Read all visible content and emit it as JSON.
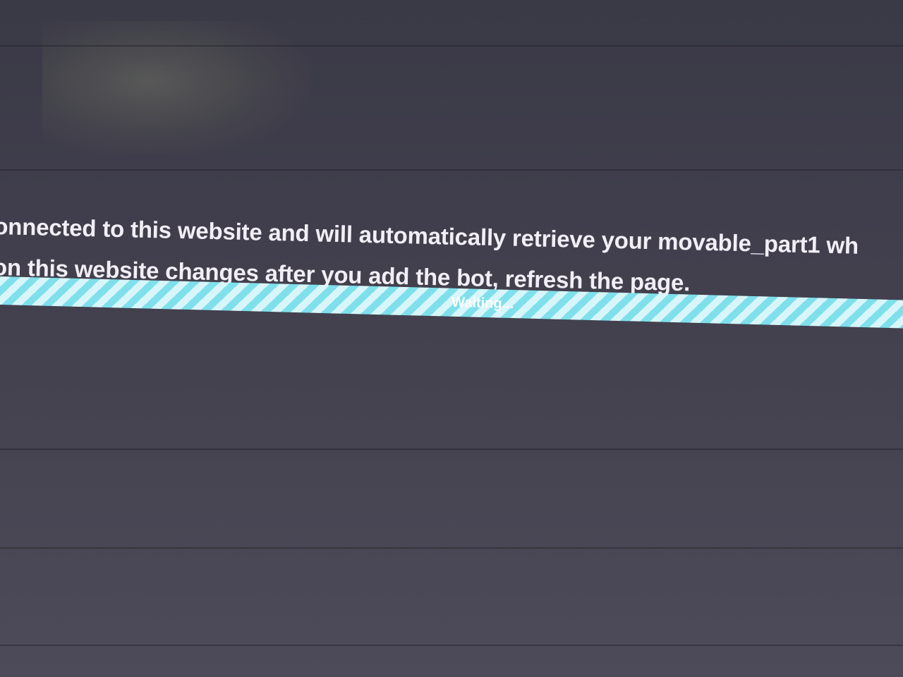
{
  "message": {
    "line1": "onnected to this website and will automatically retrieve your movable_part1 wh",
    "line2": "on this website changes after you add the bot, refresh the page."
  },
  "progress": {
    "label": "Waiting...",
    "colors": {
      "stripe_dark": "#7fe0ec",
      "stripe_light": "#d8f6fa"
    }
  },
  "colors": {
    "background": "#403e4c",
    "text": "#f2eef6"
  }
}
